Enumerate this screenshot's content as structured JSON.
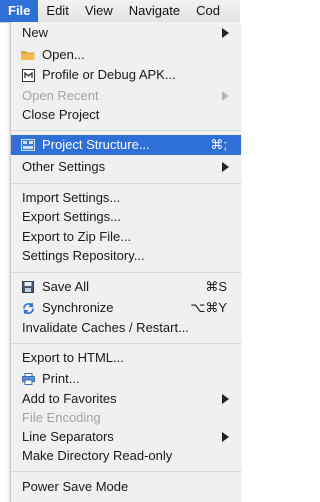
{
  "menubar": [
    "File",
    "Edit",
    "View",
    "Navigate",
    "Cod"
  ],
  "menu": {
    "new": "New",
    "open": "Open...",
    "profile_debug_apk": "Profile or Debug APK...",
    "open_recent": "Open Recent",
    "close_project": "Close Project",
    "project_structure": "Project Structure...",
    "project_structure_shortcut": "⌘;",
    "other_settings": "Other Settings",
    "import_settings": "Import Settings...",
    "export_settings": "Export Settings...",
    "export_zip": "Export to Zip File...",
    "settings_repository": "Settings Repository...",
    "save_all": "Save All",
    "save_all_shortcut": "⌘S",
    "synchronize": "Synchronize",
    "synchronize_shortcut": "⌥⌘Y",
    "invalidate_caches": "Invalidate Caches / Restart...",
    "export_html": "Export to HTML...",
    "print": "Print...",
    "add_favorites": "Add to Favorites",
    "file_encoding": "File Encoding",
    "line_separators": "Line Separators",
    "make_read_only": "Make Directory Read-only",
    "power_save": "Power Save Mode"
  },
  "colors": {
    "highlight": "#2f6fd8",
    "menu_bg": "#f0f0f0",
    "disabled_text": "#a4a4a4"
  },
  "icons": {
    "open": "folder-icon",
    "profile_debug_apk": "apk-icon",
    "project_structure": "project-structure-icon",
    "save_all": "floppy-disk-icon",
    "synchronize": "sync-icon",
    "print": "printer-icon"
  }
}
